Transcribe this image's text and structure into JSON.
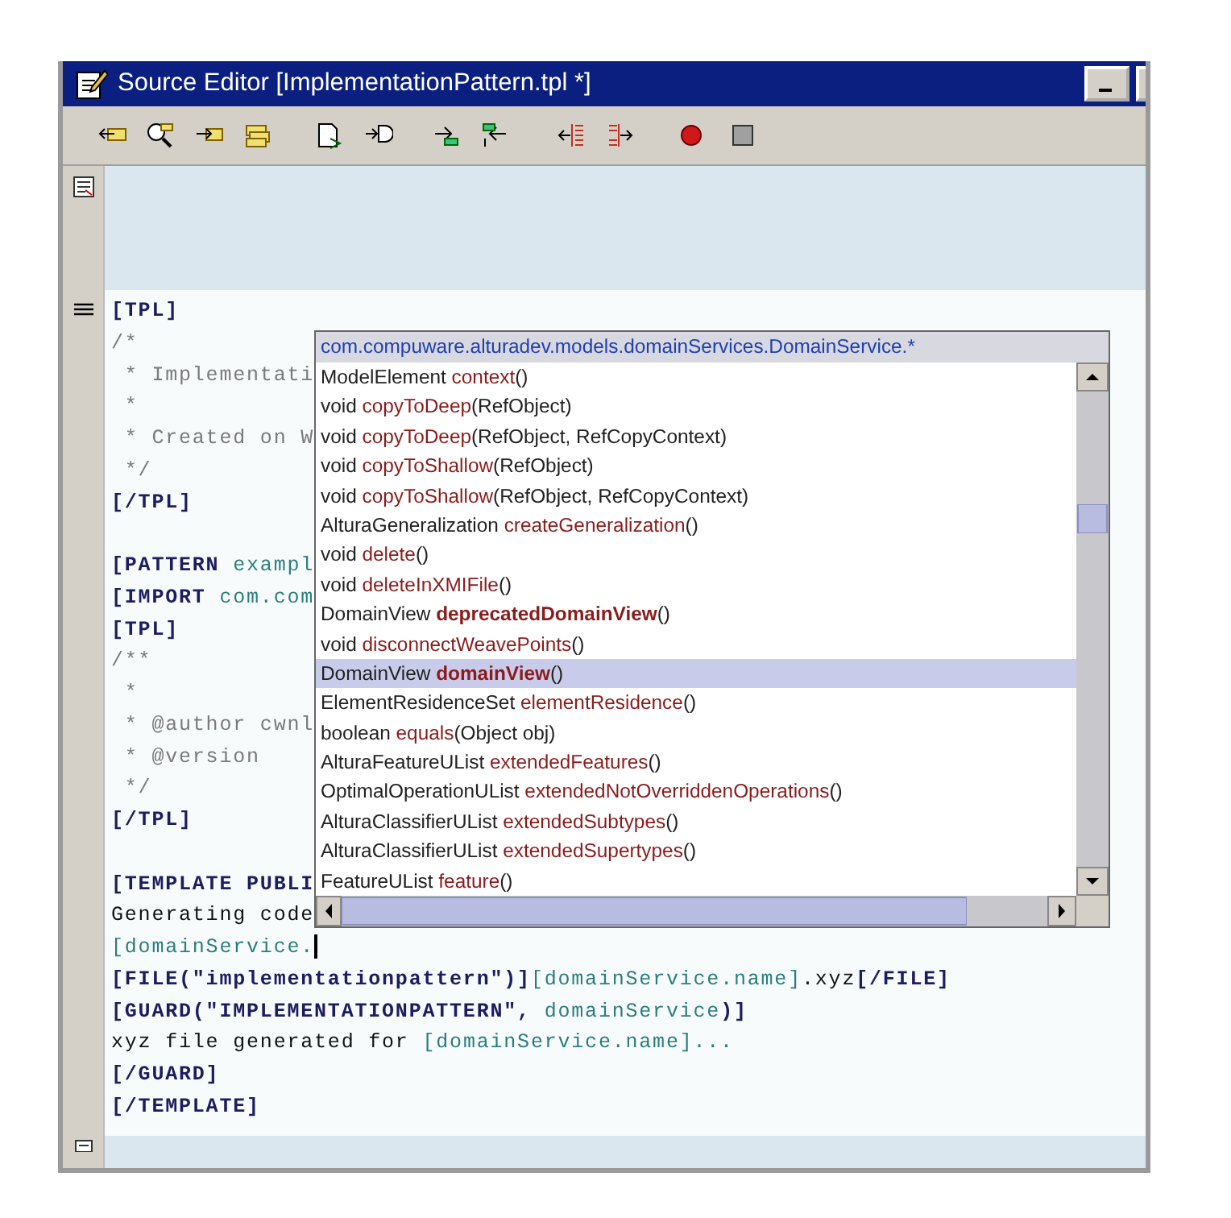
{
  "window": {
    "title": "Source Editor [ImplementationPattern.tpl *]"
  },
  "code_blocks": [
    {
      "lines": [
        {
          "cursor": false,
          "segments": [
            {
              "kind": "tag",
              "text": "[TPL]"
            }
          ]
        },
        {
          "cursor": false,
          "segments": [
            {
              "kind": "comment",
              "text": "/*"
            }
          ]
        },
        {
          "cursor": false,
          "segments": [
            {
              "kind": "comment",
              "text": " * Implementati"
            }
          ]
        },
        {
          "cursor": false,
          "segments": [
            {
              "kind": "comment",
              "text": " *"
            }
          ]
        },
        {
          "cursor": false,
          "segments": [
            {
              "kind": "comment",
              "text": " * Created on W"
            }
          ]
        },
        {
          "cursor": false,
          "segments": [
            {
              "kind": "comment",
              "text": " */"
            }
          ]
        },
        {
          "cursor": false,
          "segments": [
            {
              "kind": "tag",
              "text": "[/TPL]"
            }
          ]
        }
      ]
    },
    {
      "lines": [
        {
          "cursor": false,
          "segments": [
            {
              "kind": "tag",
              "text": "[PATTERN "
            },
            {
              "kind": "expr",
              "text": "exampl"
            }
          ]
        },
        {
          "cursor": false,
          "segments": [
            {
              "kind": "tag",
              "text": "[IMPORT "
            },
            {
              "kind": "expr",
              "text": "com.com"
            }
          ]
        },
        {
          "cursor": false,
          "segments": [
            {
              "kind": "tag",
              "text": "[TPL]"
            }
          ]
        },
        {
          "cursor": false,
          "segments": [
            {
              "kind": "comment",
              "text": "/**"
            }
          ]
        },
        {
          "cursor": false,
          "segments": [
            {
              "kind": "comment",
              "text": " *"
            }
          ]
        },
        {
          "cursor": false,
          "segments": [
            {
              "kind": "comment",
              "text": " * @author cwnl"
            }
          ]
        },
        {
          "cursor": false,
          "segments": [
            {
              "kind": "comment",
              "text": " * @version"
            }
          ]
        },
        {
          "cursor": false,
          "segments": [
            {
              "kind": "comment",
              "text": " */"
            }
          ]
        },
        {
          "cursor": false,
          "segments": [
            {
              "kind": "tag",
              "text": "[/TPL]"
            }
          ]
        }
      ]
    },
    {
      "lines": [
        {
          "cursor": false,
          "segments": [
            {
              "kind": "tag",
              "text": "[TEMPLATE PUBLI"
            }
          ]
        },
        {
          "cursor": false,
          "segments": [
            {
              "kind": "text",
              "text": "Generating code"
            }
          ]
        },
        {
          "cursor": true,
          "segments": [
            {
              "kind": "expr",
              "text": "[domainService."
            }
          ]
        },
        {
          "cursor": false,
          "segments": [
            {
              "kind": "tag",
              "text": "[FILE(\"implementationpattern\")]"
            },
            {
              "kind": "expr",
              "text": "[domainService.name]"
            },
            {
              "kind": "text",
              "text": ".xyz"
            },
            {
              "kind": "tag",
              "text": "[/FILE]"
            }
          ]
        },
        {
          "cursor": false,
          "segments": [
            {
              "kind": "tag",
              "text": "[GUARD(\"IMPLEMENTATIONPATTERN\", "
            },
            {
              "kind": "expr",
              "text": "domainService"
            },
            {
              "kind": "tag",
              "text": ")]"
            }
          ]
        },
        {
          "cursor": false,
          "segments": [
            {
              "kind": "text",
              "text": "xyz file generated for "
            },
            {
              "kind": "expr",
              "text": "[domainService.name]..."
            }
          ]
        },
        {
          "cursor": false,
          "segments": [
            {
              "kind": "tag",
              "text": "[/GUARD]"
            }
          ]
        },
        {
          "cursor": false,
          "segments": [
            {
              "kind": "tag",
              "text": "[/TEMPLATE]"
            }
          ]
        }
      ]
    }
  ],
  "completion_popup": {
    "header": "com.compuware.alturadev.models.domainServices.DomainService.*",
    "items": [
      {
        "type": "ModelElement",
        "method": "context",
        "params": "()",
        "bold": false,
        "selected": false
      },
      {
        "type": "void",
        "method": "copyToDeep",
        "params": "(RefObject)",
        "bold": false,
        "selected": false
      },
      {
        "type": "void",
        "method": "copyToDeep",
        "params": "(RefObject, RefCopyContext)",
        "bold": false,
        "selected": false
      },
      {
        "type": "void",
        "method": "copyToShallow",
        "params": "(RefObject)",
        "bold": false,
        "selected": false
      },
      {
        "type": "void",
        "method": "copyToShallow",
        "params": "(RefObject, RefCopyContext)",
        "bold": false,
        "selected": false
      },
      {
        "type": "AlturaGeneralization",
        "method": "createGeneralization",
        "params": "()",
        "bold": false,
        "selected": false
      },
      {
        "type": "void",
        "method": "delete",
        "params": "()",
        "bold": false,
        "selected": false
      },
      {
        "type": "void",
        "method": "deleteInXMIFile",
        "params": "()",
        "bold": false,
        "selected": false
      },
      {
        "type": "DomainView",
        "method": "deprecatedDomainView",
        "params": "()",
        "bold": true,
        "selected": false
      },
      {
        "type": "void",
        "method": "disconnectWeavePoints",
        "params": "()",
        "bold": false,
        "selected": false
      },
      {
        "type": "DomainView",
        "method": "domainView",
        "params": "()",
        "bold": true,
        "selected": true
      },
      {
        "type": "ElementResidenceSet",
        "method": "elementResidence",
        "params": "()",
        "bold": false,
        "selected": false
      },
      {
        "type": "boolean",
        "method": "equals",
        "params": "(Object obj)",
        "bold": false,
        "selected": false
      },
      {
        "type": "AlturaFeatureUList",
        "method": "extendedFeatures",
        "params": "()",
        "bold": false,
        "selected": false
      },
      {
        "type": "OptimalOperationUList",
        "method": "extendedNotOverriddenOperations",
        "params": "()",
        "bold": false,
        "selected": false
      },
      {
        "type": "AlturaClassifierUList",
        "method": "extendedSubtypes",
        "params": "()",
        "bold": false,
        "selected": false
      },
      {
        "type": "AlturaClassifierUList",
        "method": "extendedSupertypes",
        "params": "()",
        "bold": false,
        "selected": false
      },
      {
        "type": "FeatureUList",
        "method": "feature",
        "params": "()",
        "bold": false,
        "selected": false
      }
    ]
  }
}
